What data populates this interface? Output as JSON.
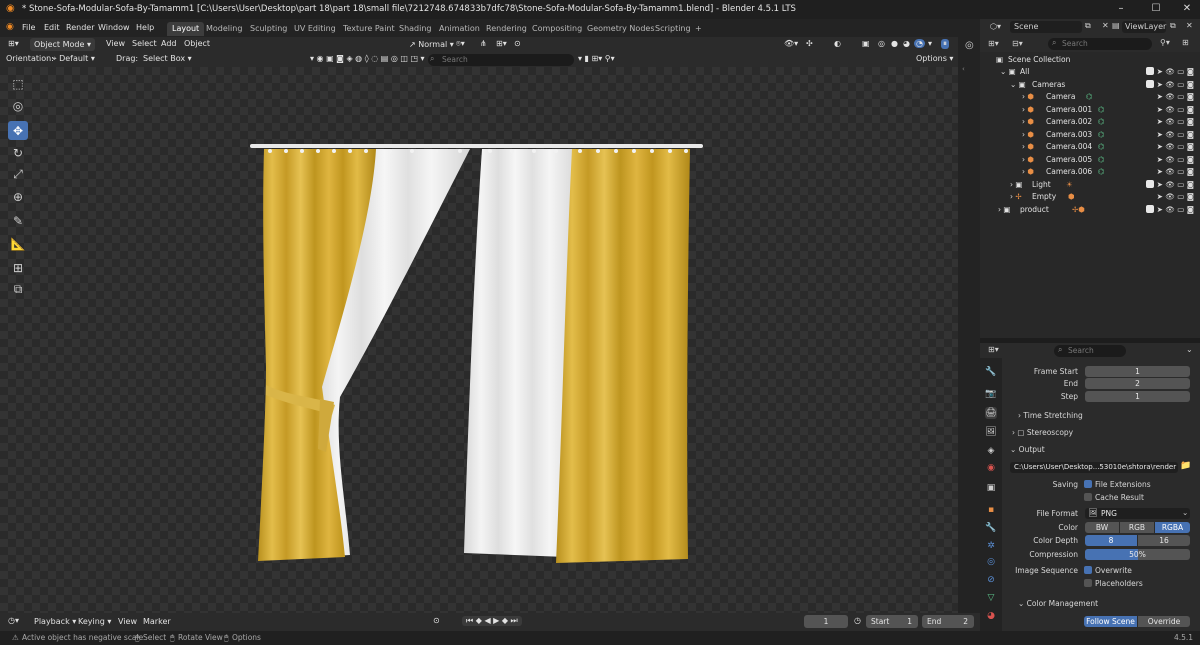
{
  "window": {
    "title": "* Stone-Sofa-Modular-Sofa-By-Tamamm1 [C:\\Users\\User\\Desktop\\part 18\\part 18\\small file\\7212748.674833b7dfc78\\Stone-Sofa-Modular-Sofa-By-Tamamm1.blend] - Blender 4.5.1 LTS"
  },
  "menu": {
    "items": [
      "File",
      "Edit",
      "Render",
      "Window",
      "Help"
    ]
  },
  "workspaces": {
    "tabs": [
      "Layout",
      "Modeling",
      "Sculpting",
      "UV Editing",
      "Texture Paint",
      "Shading",
      "Animation",
      "Rendering",
      "Compositing",
      "Geometry Nodes",
      "Scripting"
    ],
    "active": "Layout",
    "add": "+"
  },
  "viewport_header": {
    "mode": "Object Mode",
    "menus": [
      "View",
      "Select",
      "Add",
      "Object"
    ],
    "orientation_label": "Orientation:",
    "orientation_value": "Default",
    "drag_label": "Drag:",
    "drag_value": "Select Box",
    "transform": "Normal",
    "search_placeholder": "Search",
    "options": "Options"
  },
  "toolbar": {
    "tools": [
      "select-box",
      "cursor",
      "move",
      "rotate",
      "scale",
      "transform",
      "annotate",
      "measure",
      "add-cube",
      "add-object"
    ],
    "active": "move"
  },
  "timeline": {
    "playback": "Playback",
    "keying": "Keying",
    "view": "View",
    "marker": "Marker",
    "current_frame": "1",
    "start_label": "Start",
    "start_value": "1",
    "end_label": "End",
    "end_value": "2"
  },
  "statusbar": {
    "message": "Active object has negative scale",
    "hint1": "Select",
    "hint2": "Rotate View",
    "hint3": "Options",
    "version": "4.5.1"
  },
  "right_header": {
    "scene": "Scene",
    "view_layer": "ViewLayer"
  },
  "outliner": {
    "search_placeholder": "Search",
    "root": "Scene Collection",
    "rows": [
      {
        "name": "All",
        "level": 1
      },
      {
        "name": "Cameras",
        "level": 2
      },
      {
        "name": "Camera",
        "level": 3
      },
      {
        "name": "Camera.001",
        "level": 3
      },
      {
        "name": "Camera.002",
        "level": 3
      },
      {
        "name": "Camera.003",
        "level": 3
      },
      {
        "name": "Camera.004",
        "level": 3
      },
      {
        "name": "Camera.005",
        "level": 3
      },
      {
        "name": "Camera.006",
        "level": 3
      },
      {
        "name": "Light",
        "level": 2
      },
      {
        "name": "Empty",
        "level": 2
      },
      {
        "name": "product",
        "level": 1
      }
    ]
  },
  "properties": {
    "search_placeholder": "Search",
    "frame_start_label": "Frame Start",
    "frame_start": "1",
    "end_label": "End",
    "end": "2",
    "step_label": "Step",
    "step": "1",
    "time_stretching": "Time Stretching",
    "stereoscopy": "Stereoscopy",
    "output": "Output",
    "output_path": "C:\\Users\\User\\Desktop...53010e\\shtora\\render",
    "saving_label": "Saving",
    "file_extensions": "File Extensions",
    "cache_result": "Cache Result",
    "file_format_label": "File Format",
    "file_format": "PNG",
    "color_label": "Color",
    "color_options": [
      "BW",
      "RGB",
      "RGBA"
    ],
    "color_selected": "RGBA",
    "color_depth_label": "Color Depth",
    "color_depth_options": [
      "8",
      "16"
    ],
    "color_depth_selected": "8",
    "compression_label": "Compression",
    "compression": "50%",
    "compression_value": 0.5,
    "image_sequence_label": "Image Sequence",
    "overwrite": "Overwrite",
    "placeholders": "Placeholders",
    "color_management": "Color Management",
    "cm_options": [
      "Follow Scene",
      "Override"
    ],
    "cm_selected": "Follow Scene"
  },
  "colors": {
    "accent": "#4772b3",
    "curtain_gold": "#d4a932",
    "curtain_white": "#ececec"
  }
}
